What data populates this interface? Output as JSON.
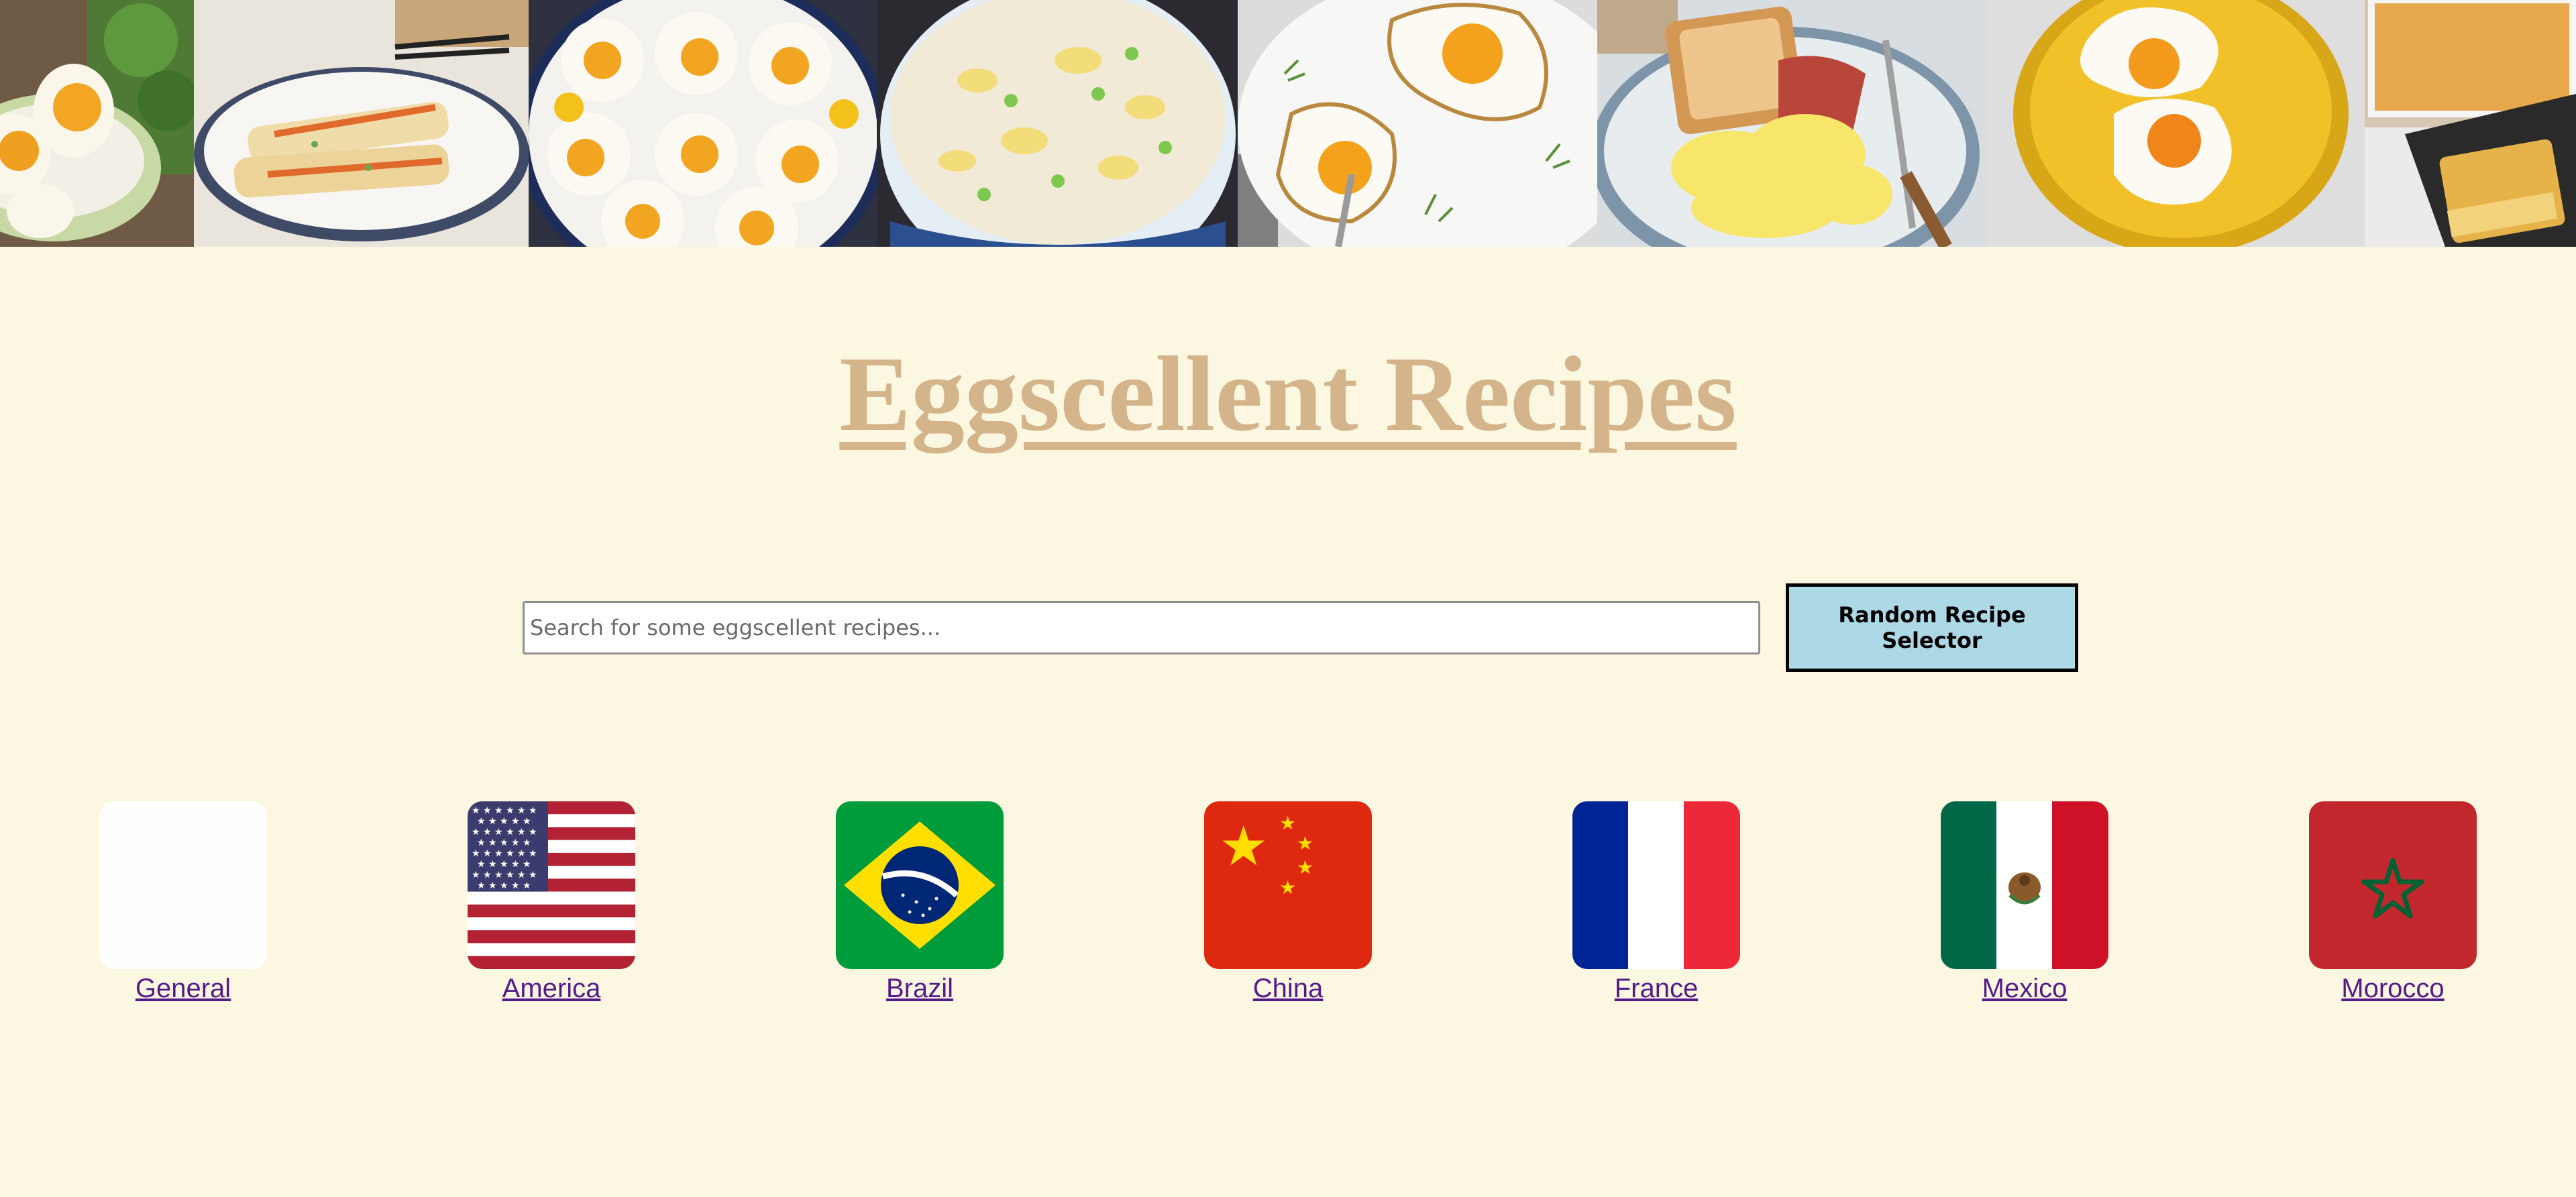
{
  "page": {
    "title": "Eggscellent Recipes",
    "title_color": "#d4b48b",
    "background": "#fcf7e0"
  },
  "photos": [
    {
      "name": "boiled-eggs-photo"
    },
    {
      "name": "egg-crepe-rolls-photo"
    },
    {
      "name": "poached-eggs-plate-photo"
    },
    {
      "name": "egg-fried-rice-photo"
    },
    {
      "name": "fried-eggs-herbs-photo"
    },
    {
      "name": "scrambled-eggs-toast-photo"
    },
    {
      "name": "sunny-side-eggs-yellow-plate-photo"
    },
    {
      "name": "egg-casserole-photo"
    }
  ],
  "search": {
    "placeholder": "Search for some eggscellent recipes...",
    "value": ""
  },
  "random_button": {
    "label": "Random Recipe Selector",
    "background": "#add8e6"
  },
  "countries": [
    {
      "label": "General",
      "icon": "white-flag-icon"
    },
    {
      "label": "America",
      "icon": "usa-flag-icon"
    },
    {
      "label": "Brazil",
      "icon": "brazil-flag-icon"
    },
    {
      "label": "China",
      "icon": "china-flag-icon"
    },
    {
      "label": "France",
      "icon": "france-flag-icon"
    },
    {
      "label": "Mexico",
      "icon": "mexico-flag-icon"
    },
    {
      "label": "Morocco",
      "icon": "morocco-flag-icon"
    }
  ],
  "link_color": "#551a8b"
}
